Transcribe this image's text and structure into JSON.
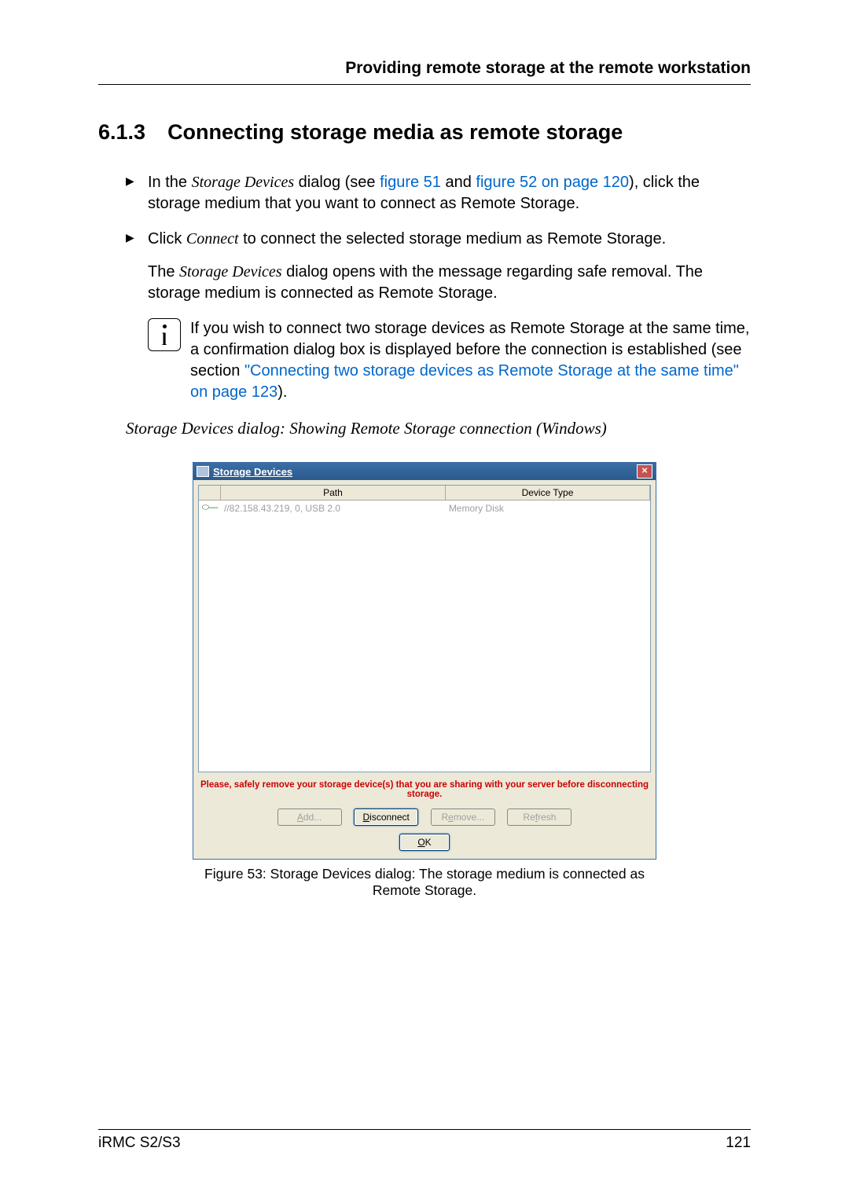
{
  "header": {
    "running_title": "Providing remote storage at the remote workstation"
  },
  "section": {
    "number": "6.1.3",
    "title": "Connecting storage media as remote storage"
  },
  "steps": {
    "step1_pre": "In the ",
    "step1_italic": "Storage Devices",
    "step1_mid": " dialog (see ",
    "step1_link1": "figure 51",
    "step1_and": " and ",
    "step1_link2": "figure 52 on page 120",
    "step1_post": "), click the storage medium that you want to connect as Remote Storage.",
    "step2_pre": "Click ",
    "step2_italic": "Connect",
    "step2_post": " to connect the selected storage medium as Remote Storage.",
    "result_pre": "The ",
    "result_italic": "Storage Devices",
    "result_post": " dialog opens with the message regarding safe removal. The storage medium is connected as Remote Storage."
  },
  "note": {
    "text_pre": "If you wish to connect two storage devices as Remote Storage at the same time, a confirmation dialog box is displayed before the connection is established (see section ",
    "link": "\"Connecting two storage devices as Remote Storage at the same time\" on page 123",
    "text_post": ")."
  },
  "figure_title": "Storage Devices dialog: Showing Remote Storage connection (Windows)",
  "dialog": {
    "title": "Storage Devices",
    "close": "×",
    "columns": {
      "path": "Path",
      "type": "Device Type"
    },
    "row": {
      "path": "//82.158.43.219, 0, USB 2.0",
      "type": "Memory Disk"
    },
    "warning": "Please, safely remove your storage device(s) that you are sharing with your server before disconnecting storage.",
    "buttons": {
      "add": "Add...",
      "disconnect": "Disconnect",
      "remove": "Remove...",
      "refresh": "Refresh",
      "ok": "OK"
    }
  },
  "figure_caption": "Figure 53: Storage Devices dialog: The storage medium is connected as Remote Storage.",
  "footer": {
    "left": "iRMC S2/S3",
    "right": "121"
  }
}
